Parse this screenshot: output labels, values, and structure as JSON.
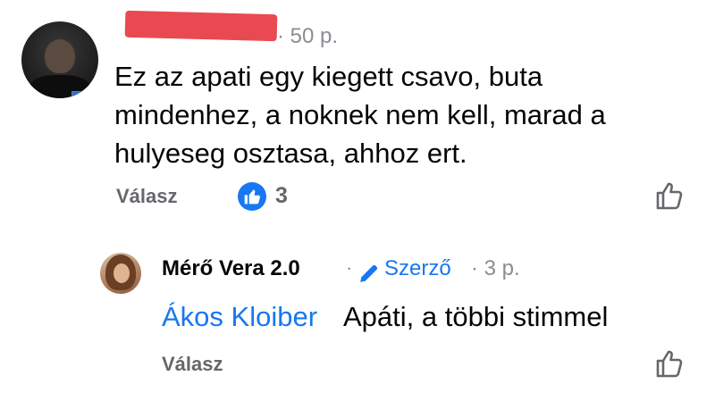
{
  "comment1": {
    "time": "· 50 p.",
    "text": "Ez az apati egy kiegett csavo, buta mindenhez, a noknek nem kell, marad a hulyeseg osztasa, ahhoz ert.",
    "reply_label": "Válasz",
    "reaction_icon": "thumbs-up-icon",
    "reaction_count": "3",
    "like_icon": "thumbs-up-outline-icon"
  },
  "comment2": {
    "author": "Mérő Vera 2.0",
    "separator": "·",
    "author_badge": "Szerző",
    "time": "· 3 p.",
    "mention": "Ákos Kloiber",
    "text": "Apáti, a többi stimmel",
    "reply_label": "Válasz",
    "like_icon": "thumbs-up-outline-icon"
  },
  "colors": {
    "link_blue": "#1877f2",
    "meta_gray": "#8a8d91",
    "action_gray": "#65676b",
    "redaction_red": "#e8434a"
  }
}
